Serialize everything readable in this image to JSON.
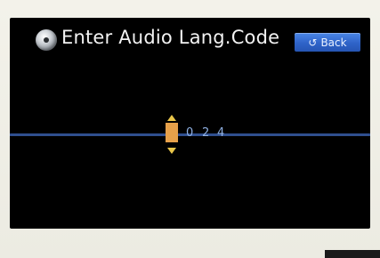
{
  "screen": {
    "title": "Enter Audio Lang.Code",
    "back_label": "Back",
    "back_icon": "return-arrow-icon",
    "title_icon": "disc-icon"
  },
  "code_entry": {
    "selected_char": "",
    "digits": [
      "0",
      "2",
      "4"
    ]
  },
  "colors": {
    "background": "#000000",
    "back_button": "#2f63c8",
    "selected_cell": "#e7a14a",
    "arrows": "#e9c64a",
    "digits": "#8fb0e3",
    "guide_line": "#2f4f8e"
  }
}
